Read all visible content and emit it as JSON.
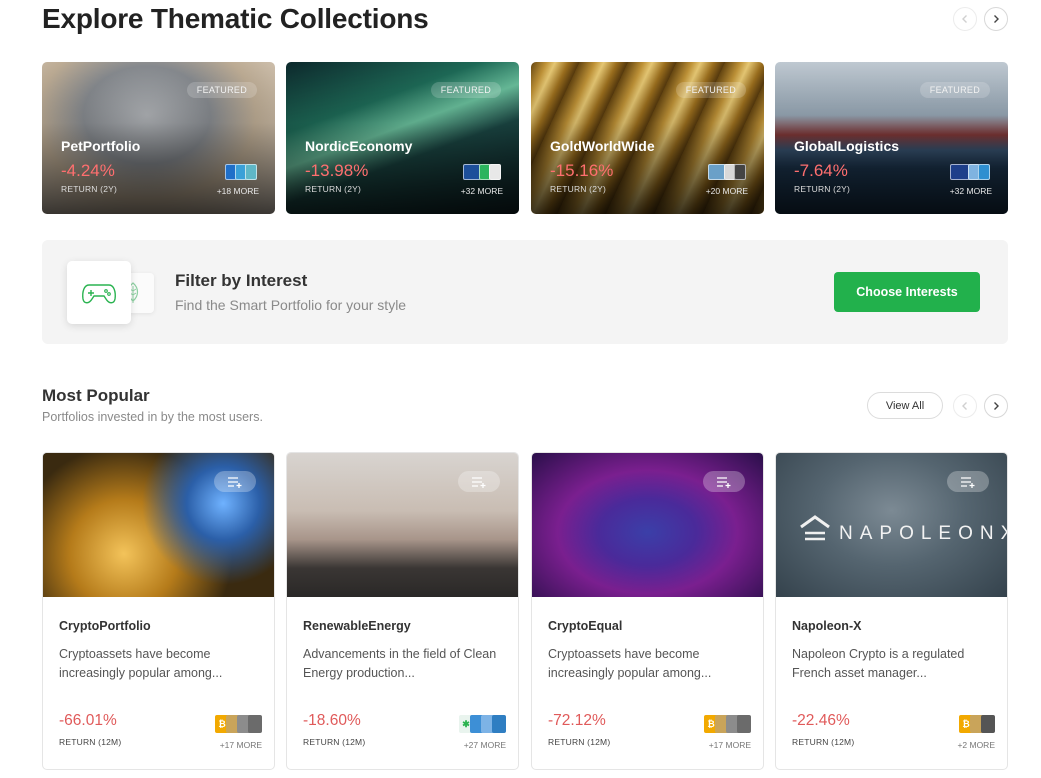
{
  "explore": {
    "title": "Explore Thematic Collections",
    "featured_cards": [
      {
        "name": "PetPortfolio",
        "badge": "FEATURED",
        "return": "-4.24%",
        "return_label": "RETURN (2Y)",
        "more": "+18 MORE"
      },
      {
        "name": "NordicEconomy",
        "badge": "FEATURED",
        "return": "-13.98%",
        "return_label": "RETURN (2Y)",
        "more": "+32 MORE"
      },
      {
        "name": "GoldWorldWide",
        "badge": "FEATURED",
        "return": "-15.16%",
        "return_label": "RETURN (2Y)",
        "more": "+20 MORE"
      },
      {
        "name": "GlobalLogistics",
        "badge": "FEATURED",
        "return": "-7.64%",
        "return_label": "RETURN (2Y)",
        "more": "+32 MORE"
      }
    ]
  },
  "filter": {
    "title": "Filter by Interest",
    "subtitle": "Find the Smart Portfolio for your style",
    "button": "Choose Interests"
  },
  "popular": {
    "title": "Most Popular",
    "subtitle": "Portfolios invested in by the most users.",
    "view_all": "View All",
    "napoleon_logo_text": "NAPOLEONX",
    "cards": [
      {
        "name": "CryptoPortfolio",
        "description": "Cryptoassets have become increasingly popular among...",
        "return": "-66.01%",
        "return_label": "RETURN (12M)",
        "more": "+17 MORE"
      },
      {
        "name": "RenewableEnergy",
        "description": "Advancements in the field of Clean Energy production...",
        "return": "-18.60%",
        "return_label": "RETURN (12M)",
        "more": "+27 MORE"
      },
      {
        "name": "CryptoEqual",
        "description": "Cryptoassets have become increasingly popular among...",
        "return": "-72.12%",
        "return_label": "RETURN (12M)",
        "more": "+17 MORE"
      },
      {
        "name": "Napoleon-X",
        "description": "Napoleon Crypto is a regulated French asset manager...",
        "return": "-22.46%",
        "return_label": "RETURN (12M)",
        "more": "+2 MORE"
      }
    ]
  },
  "colors": {
    "accent_green": "#22b14c",
    "negative_red": "#e05a5a"
  }
}
